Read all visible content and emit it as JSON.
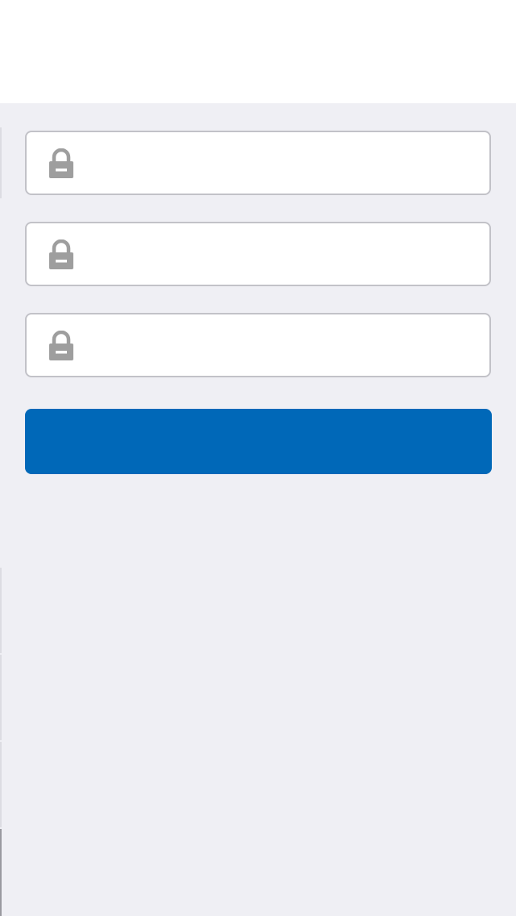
{
  "header": {
    "title": ""
  },
  "form": {
    "fields": [
      {
        "value": "",
        "placeholder": "",
        "icon": "lock-icon"
      },
      {
        "value": "",
        "placeholder": "",
        "icon": "lock-icon"
      },
      {
        "value": "",
        "placeholder": "",
        "icon": "lock-icon"
      }
    ],
    "submit_label": ""
  },
  "colors": {
    "background": "#efeff4",
    "header_background": "#ffffff",
    "field_border": "#c2c2c8",
    "icon": "#9e9e9e",
    "button": "#0068b8"
  }
}
